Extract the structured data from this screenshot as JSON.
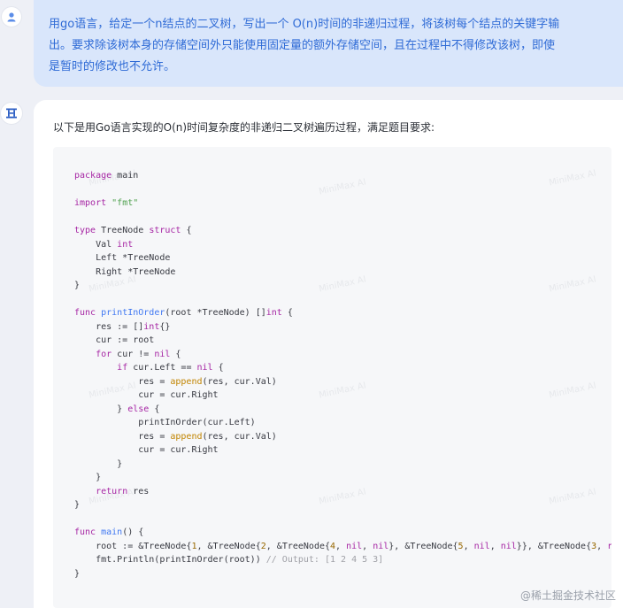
{
  "user_message": {
    "line1": "用go语言，给定一个n结点的二叉树，写出一个 O(n)时间的非递归过程，将该树每个结点的关键字输",
    "line2": "出。要求除该树本身的存储空间外只能使用固定量的额外存储空间，且在过程中不得修改该树，即使",
    "line3": "是暂时的修改也不允许。"
  },
  "assistant": {
    "intro": "以下是用Go语言实现的O(n)时间复杂度的非递归二叉树遍历过程，满足题目要求:"
  },
  "watermark": "@稀土掘金技术社区",
  "colors": {
    "user_bubble": "#d9e6fb",
    "user_text": "#2f6bd6",
    "code_bg": "#f6f7f9",
    "keyword": "#a626a4",
    "function": "#4078f2",
    "string": "#50a14f",
    "number": "#986801"
  },
  "icons": {
    "user_avatar": "user-icon",
    "assistant_avatar": "bot-logo-icon"
  }
}
